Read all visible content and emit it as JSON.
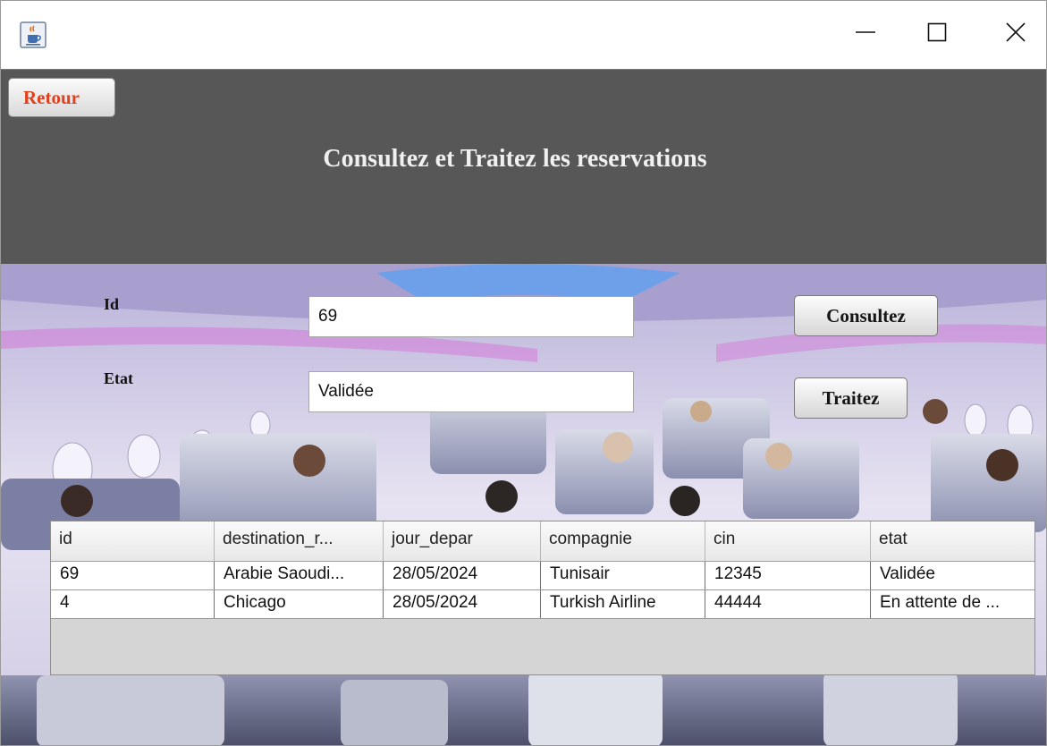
{
  "window": {
    "icons": {
      "app": "java-cup-icon",
      "minimize": "minimize-icon",
      "maximize": "maximize-icon",
      "close": "close-icon"
    }
  },
  "header": {
    "back_label": "Retour",
    "title": "Consultez et Traitez les reservations",
    "background": "#575757",
    "back_color": "#e0401d"
  },
  "form": {
    "id_label": "Id",
    "id_value": "69",
    "etat_label": "Etat",
    "etat_value": "Validée",
    "consult_label": "Consultez",
    "process_label": "Traitez"
  },
  "table": {
    "columns": [
      "id",
      "destination_r...",
      "jour_depar",
      "compagnie",
      "cin",
      "etat"
    ],
    "rows": [
      [
        "69",
        "Arabie Saoudi...",
        "28/05/2024",
        "Tunisair",
        "12345",
        "Validée"
      ],
      [
        "4",
        "Chicago",
        "28/05/2024",
        "Turkish Airline",
        "44444",
        "En attente de ..."
      ]
    ]
  }
}
